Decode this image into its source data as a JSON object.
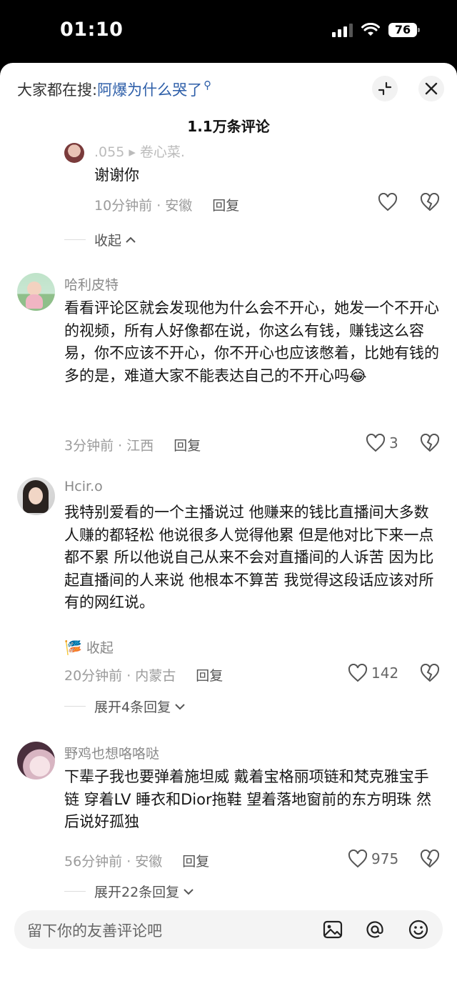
{
  "status_bar": {
    "time": "01:10",
    "battery": "76"
  },
  "header": {
    "search_prefix": "大家都在搜:",
    "search_query": "阿爆为什么哭了",
    "title": "1.1万条评论"
  },
  "comments": [
    {
      "username": ".055 ▸ 卷心菜.",
      "text": "谢谢你",
      "time_location": "10分钟前 · 安徽",
      "reply_label": "回复",
      "likes": "",
      "collapse_label": "收起"
    },
    {
      "username": "哈利皮特",
      "text": "看看评论区就会发现他为什么会不开心，她发一个不开心的视频，所有人好像都在说，你这么有钱，赚钱这么容易，你不应该不开心，你不开心也应该憋着，比她有钱的多的是，难道大家不能表达自己的不开心吗😂",
      "time_location": "3分钟前 · 江西",
      "reply_label": "回复",
      "likes": "3"
    },
    {
      "username": "Hcir.o",
      "text": "我特别爱看的一个主播说过 他赚来的钱比直播间大多数人赚的都轻松 他说很多人觉得他累 但是他对比下来一点都不累 所以他说自己从来不会对直播间的人诉苦 因为比起直播间的人来说 他根本不算苦 我觉得这段话应该对所有的网红说。",
      "collapse_label": "收起",
      "time_location": "20分钟前 · 内蒙古",
      "reply_label": "回复",
      "likes": "142",
      "expand_label": "展开4条回复"
    },
    {
      "username": "野鸡也想咯咯哒",
      "text": "下辈子我也要弹着施坦威 戴着宝格丽项链和梵克雅宝手链 穿着LV 睡衣和Dior拖鞋 望着落地窗前的东方明珠 然后说好孤独",
      "time_location": "56分钟前 · 安徽",
      "reply_label": "回复",
      "likes": "975",
      "expand_label": "展开22条回复"
    }
  ],
  "input": {
    "placeholder": "留下你的友善评论吧"
  },
  "icons": {
    "heart": "heart-icon",
    "dislike": "broken-heart-icon",
    "image": "image-icon",
    "mention": "at-icon",
    "emoji": "emoji-icon",
    "close": "close-icon",
    "collapse": "collapse-icon"
  },
  "colors": {
    "link": "#2d5ea8",
    "meta": "#9b9b9b",
    "text": "#161616"
  }
}
